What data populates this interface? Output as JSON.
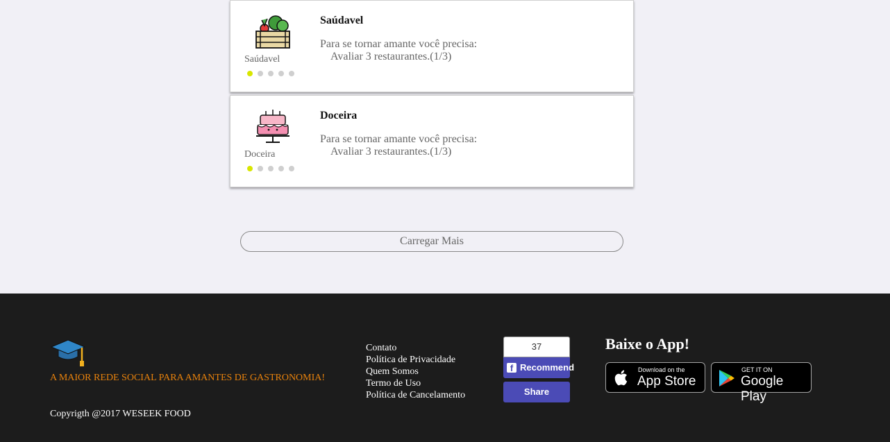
{
  "cards": [
    {
      "icon": "vegetable-crate-icon",
      "category_label": "Saúdavel",
      "title": "Saúdavel",
      "requirement": "Para se tornar amante você precisa:",
      "task": "Avaliar 3 restaurantes.(1/3)",
      "progress_level": 1,
      "progress_total": 5
    },
    {
      "icon": "cake-icon",
      "category_label": "Doceira",
      "title": "Doceira",
      "requirement": "Para se tornar amante você precisa:",
      "task": "Avaliar 3 restaurantes.(1/3)",
      "progress_level": 1,
      "progress_total": 5
    }
  ],
  "load_more_label": "Carregar Mais",
  "footer": {
    "logo_icon": "graduation-cap-icon",
    "tagline": "A MAIOR REDE SOCIAL PARA AMANTES DE GASTRONOMIA!",
    "copyright": "Copyrigth @2017 WESEEK FOOD",
    "links": [
      "Contato",
      "Política de Privacidade",
      "Quem Somos",
      "Termo de Uso",
      "Política de Cancelamento"
    ],
    "facebook": {
      "count": "37",
      "recommend_label": "Recommend",
      "share_label": "Share"
    },
    "app_title": "Baixe o App!",
    "app_store": {
      "small": "Download on the",
      "big": "App Store"
    },
    "google_play": {
      "small": "GET IT ON",
      "big": "Google Play"
    }
  },
  "colors": {
    "page_bg": "#f1f0f6",
    "footer_bg": "#1c1c1c",
    "tagline": "#e8820c",
    "dot_active": "#d8e600",
    "facebook_button": "#4b4bb6"
  }
}
